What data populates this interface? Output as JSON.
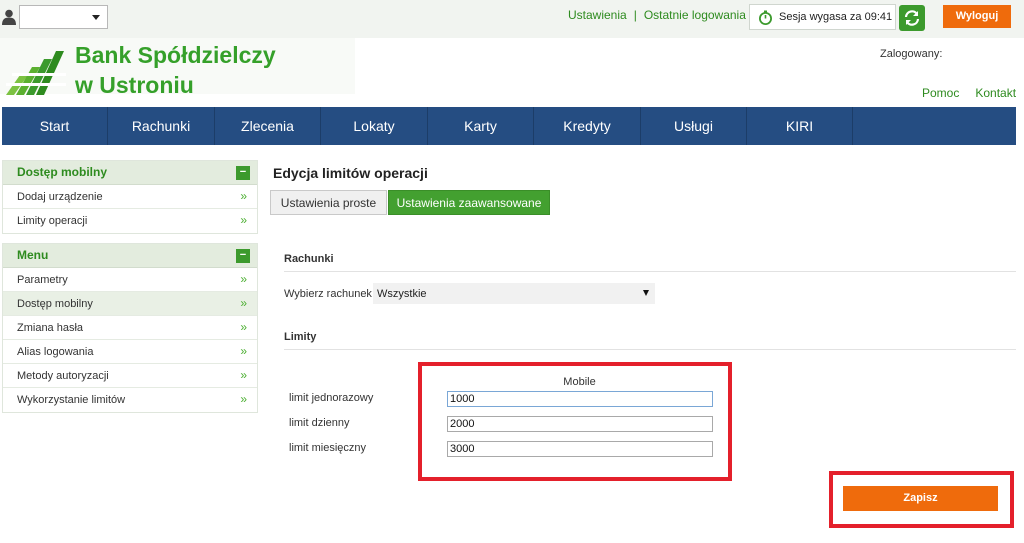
{
  "topbar": {
    "links": [
      "Ustawienia",
      "Ostatnie logowania"
    ],
    "session_text": "Sesja wygasa za 09:41",
    "logout_label": "Wyloguj",
    "profile_value": ""
  },
  "header": {
    "bank_name_line1": "Bank Spółdzielczy",
    "bank_name_line2": "w Ustroniu",
    "logged_in_label": "Zalogowany:",
    "help_label": "Pomoc",
    "contact_label": "Kontakt"
  },
  "nav": {
    "items": [
      "Start",
      "Rachunki",
      "Zlecenia",
      "Lokaty",
      "Karty",
      "Kredyty",
      "Usługi",
      "KIRI"
    ]
  },
  "sidebar": {
    "mobile_title": "Dostęp mobilny",
    "mobile_items": [
      "Dodaj urządzenie",
      "Limity operacji"
    ],
    "menu_title": "Menu",
    "menu_items": [
      "Parametry",
      "Dostęp mobilny",
      "Zmiana hasła",
      "Alias logowania",
      "Metody autoryzacji",
      "Wykorzystanie limitów"
    ],
    "arrow": "»",
    "collapse": "−"
  },
  "main": {
    "title": "Edycja limitów operacji",
    "tabs": [
      "Ustawienia proste",
      "Ustawienia zaawansowane"
    ],
    "accounts_section": "Rachunki",
    "account_label": "Wybierz rachunek",
    "account_value": "Wszystkie",
    "limits_section": "Limity",
    "column_header": "Mobile",
    "limits": [
      {
        "label": "limit jednorazowy",
        "value": "1000"
      },
      {
        "label": "limit dzienny",
        "value": "2000"
      },
      {
        "label": "limit miesięczny",
        "value": "3000"
      }
    ],
    "save_label": "Zapisz"
  },
  "colors": {
    "brand_green": "#35a02a",
    "nav_blue": "#254d82",
    "accent_orange": "#ef6b0c",
    "highlight_red": "#e4202b"
  }
}
